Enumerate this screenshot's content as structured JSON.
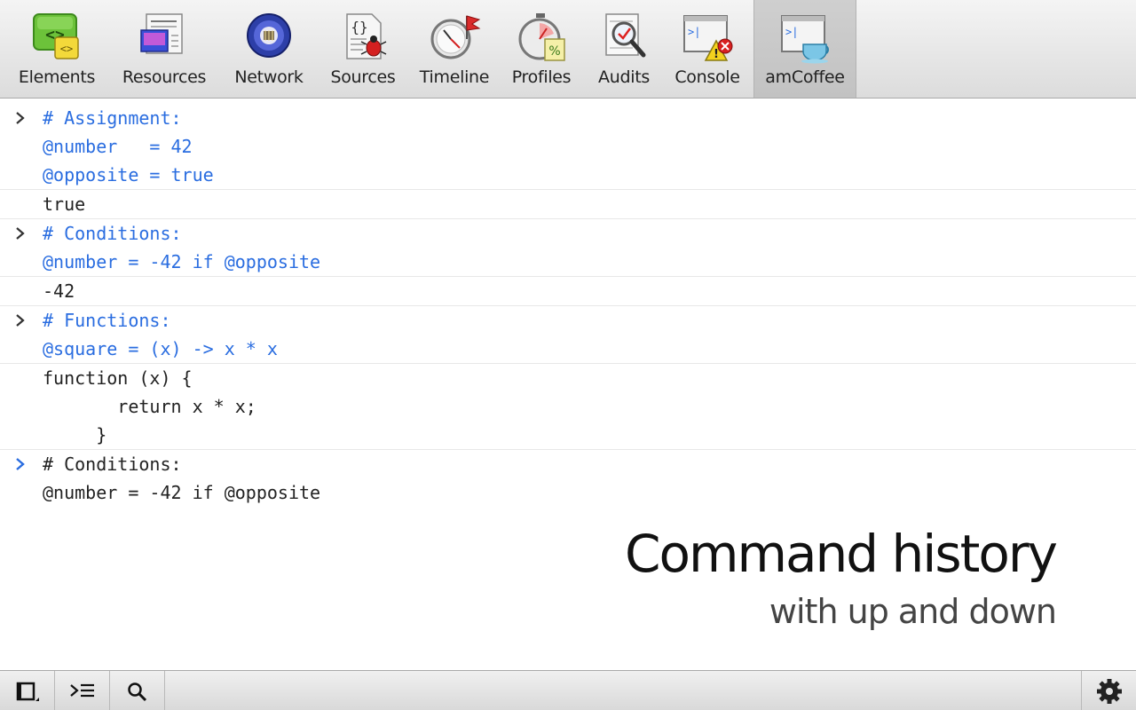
{
  "toolbar": {
    "tabs": [
      {
        "label": "Elements",
        "icon": "elements-icon",
        "selected": false
      },
      {
        "label": "Resources",
        "icon": "resources-icon",
        "selected": false
      },
      {
        "label": "Network",
        "icon": "network-icon",
        "selected": false
      },
      {
        "label": "Sources",
        "icon": "sources-icon",
        "selected": false
      },
      {
        "label": "Timeline",
        "icon": "timeline-icon",
        "selected": false
      },
      {
        "label": "Profiles",
        "icon": "profiles-icon",
        "selected": false
      },
      {
        "label": "Audits",
        "icon": "audits-icon",
        "selected": false
      },
      {
        "label": "Console",
        "icon": "console-icon",
        "selected": false
      },
      {
        "label": "amCoffee",
        "icon": "amcoffee-icon",
        "selected": true
      }
    ]
  },
  "console": {
    "entries": [
      {
        "command": [
          "# Assignment:",
          "@number   = 42",
          "@opposite = true"
        ],
        "result": [
          "true"
        ]
      },
      {
        "command": [
          "# Conditions:",
          "@number = -42 if @opposite"
        ],
        "result": [
          "-42"
        ]
      },
      {
        "command": [
          "# Functions:",
          "@square = (x) -> x * x"
        ],
        "result": [
          "function (x) {",
          "       return x * x;",
          "     }"
        ]
      },
      {
        "command": [
          "# Conditions:",
          "@number = -42 if @opposite"
        ],
        "current": true
      }
    ]
  },
  "caption": {
    "title": "Command history",
    "subtitle": "with up and down"
  },
  "statusbar": {
    "buttons": [
      "dock-toggle-icon",
      "console-drawer-icon",
      "search-icon",
      "settings-gear-icon"
    ]
  },
  "colors": {
    "command_text": "#2a6de0",
    "output_text": "#222222",
    "prompt_active": "#2a6de0",
    "prompt_inactive": "#333333"
  }
}
